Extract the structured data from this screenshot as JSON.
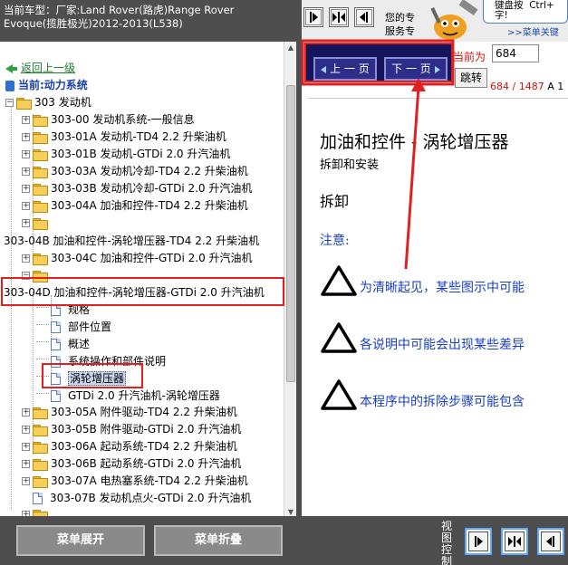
{
  "header": {
    "vehicle_line1": "当前车型：厂家:Land Rover(路虎)Range Rover",
    "vehicle_line2": "Evoque(揽胜极光)2012-2013(L538)",
    "assist_line1": "您的专",
    "assist_line2": "服务专",
    "bubble_line1": "键盘按",
    "bubble_line1b": "Ctrl+",
    "bubble_line2": "字!",
    "menu_link": ">>菜单关键"
  },
  "tree": {
    "back_label": "返回上一级",
    "current_label": "当前:动力系统",
    "root_label": "303 发动机",
    "items": [
      {
        "label": "303-00 发动机系统-一般信息"
      },
      {
        "label": "303-01A 发动机-TD4 2.2 升柴油机"
      },
      {
        "label": "303-01B 发动机-GTDi 2.0 升汽油机"
      },
      {
        "label": "303-03A 发动机冷却-TD4 2.2 升柴油机"
      },
      {
        "label": "303-03B 发动机冷却-GTDi 2.0 升汽油机"
      },
      {
        "label": "303-04A 加油和控件-TD4 2.2 升柴油机"
      },
      {
        "label": ""
      },
      {
        "label": "303-04B 加油和控件-涡轮增压器-TD4 2.2 升柴油机"
      },
      {
        "label": "303-04C 加油和控件-GTDi 2.0 升汽油机"
      },
      {
        "label": ""
      },
      {
        "label": "303-04D 加油和控件-涡轮增压器-GTDi 2.0 升汽油机"
      }
    ],
    "children": [
      {
        "label": "规格"
      },
      {
        "label": "部件位置"
      },
      {
        "label": "概述"
      },
      {
        "label": "系统操作和部件说明"
      },
      {
        "label": "涡轮增压器"
      },
      {
        "label": "GTDi 2.0 升汽油机-涡轮增压器"
      }
    ],
    "after_items": [
      {
        "label": "303-05A 附件驱动-TD4 2.2 升柴油机"
      },
      {
        "label": "303-05B 附件驱动-GTDi 2.0 升汽油机"
      },
      {
        "label": "303-06A 起动系统-TD4 2.2 升柴油机"
      },
      {
        "label": "303-06B 起动系统-GTDi 2.0 升汽油机"
      },
      {
        "label": "303-07A 电热塞系统-TD4 2.2 升柴油机"
      },
      {
        "label": "303-07B 发动机点火-GTDi 2.0 升汽油机"
      }
    ]
  },
  "pager": {
    "prev_label": "上 一 页",
    "next_label": "下 一 页",
    "current_label": "当前为",
    "page_value": "684",
    "jump_label": "跳转",
    "count_text": "684 / 1487",
    "count_suffix": "A 1"
  },
  "content": {
    "title": "加油和控件 - 涡轮增压器",
    "subtitle": "拆卸和安装",
    "section": "拆卸",
    "note_label": "注意:",
    "notes": [
      "为清晰起见，某些图示中可能",
      "各说明中可能会出现某些差异",
      "本程序中的拆除步骤可能包含"
    ]
  },
  "bottom": {
    "expand_label": "菜单展开",
    "collapse_label": "菜单折叠",
    "view_label": "视图控制"
  },
  "colors": {
    "dark_bg": "#4e4e4e",
    "highlight_red": "#e02020",
    "link_green": "#1a7f2a",
    "current_blue": "#1a3fa8",
    "content_blue": "#1a3fc0",
    "pager_navy": "#2d2d8a"
  },
  "icons": {
    "back": "back-arrow-icon",
    "folder": "folder-icon",
    "document": "document-icon",
    "warning": "warning-triangle-icon",
    "view_left": "panel-left-icon",
    "view_split": "panel-split-icon",
    "view_right": "panel-right-icon"
  }
}
